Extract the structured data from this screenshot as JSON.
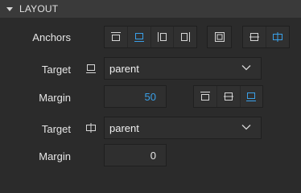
{
  "section": {
    "title": "LAYOUT"
  },
  "anchors": {
    "label": "Anchors",
    "group1": [
      "anchor-top-icon",
      "anchor-bottom-icon",
      "anchor-left-icon",
      "anchor-right-icon"
    ],
    "group2": [
      "anchor-fill-icon"
    ],
    "group3": [
      "anchor-vertical-center-icon",
      "anchor-horizontal-center-icon"
    ],
    "active": [
      "anchor-bottom-icon",
      "anchor-horizontal-center-icon"
    ]
  },
  "target1": {
    "label": "Target",
    "icon": "anchor-bottom-icon",
    "value": "parent"
  },
  "margin1": {
    "label": "Margin",
    "value": "50",
    "align": [
      "align-top-icon",
      "align-vertical-center-icon",
      "align-bottom-icon"
    ],
    "active": "align-bottom-icon"
  },
  "target2": {
    "label": "Target",
    "icon": "anchor-horizontal-center-icon",
    "value": "parent"
  },
  "margin2": {
    "label": "Margin",
    "value": "0"
  },
  "colors": {
    "accent": "#3aa0e8",
    "icon": "#d6d6d6"
  }
}
